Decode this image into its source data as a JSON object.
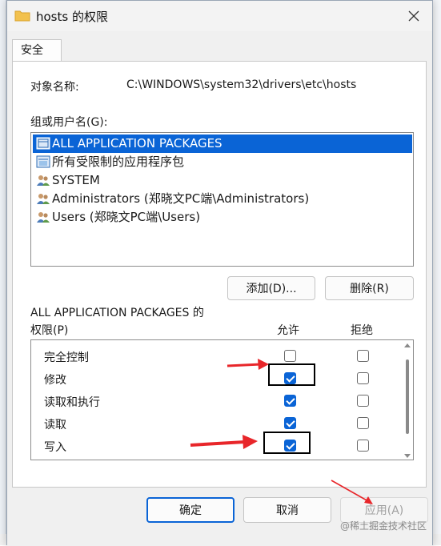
{
  "window": {
    "title": "hosts 的权限",
    "close_icon": "close-icon"
  },
  "tabs": [
    {
      "label": "安全"
    }
  ],
  "object": {
    "label": "对象名称:",
    "value": "C:\\WINDOWS\\system32\\drivers\\etc\\hosts"
  },
  "groups": {
    "label": "组或用户名(G):",
    "items": [
      {
        "name": "ALL APPLICATION PACKAGES",
        "icon": "app-package-icon",
        "selected": true
      },
      {
        "name": "所有受限制的应用程序包",
        "icon": "app-package-icon",
        "selected": false
      },
      {
        "name": "SYSTEM",
        "icon": "users-icon",
        "selected": false
      },
      {
        "name": "Administrators (郑晓文PC端\\Administrators)",
        "icon": "users-icon",
        "selected": false
      },
      {
        "name": "Users (郑晓文PC端\\Users)",
        "icon": "users-icon",
        "selected": false
      }
    ]
  },
  "buttons": {
    "add": "添加(D)...",
    "remove": "删除(R)",
    "ok": "确定",
    "cancel": "取消",
    "apply": "应用(A)"
  },
  "permissions": {
    "title_line1": "ALL APPLICATION PACKAGES 的",
    "title_line2": "权限(P)",
    "allow_header": "允许",
    "deny_header": "拒绝",
    "rows": [
      {
        "name": "完全控制",
        "allow": false,
        "deny": false
      },
      {
        "name": "修改",
        "allow": true,
        "deny": false
      },
      {
        "name": "读取和执行",
        "allow": true,
        "deny": false
      },
      {
        "name": "读取",
        "allow": true,
        "deny": false
      },
      {
        "name": "写入",
        "allow": true,
        "deny": false
      }
    ]
  },
  "watermark": "@稀土掘金技术社区",
  "colors": {
    "accent": "#0a64d6",
    "arrow": "#e8262a",
    "folder": "#f2c14e"
  }
}
